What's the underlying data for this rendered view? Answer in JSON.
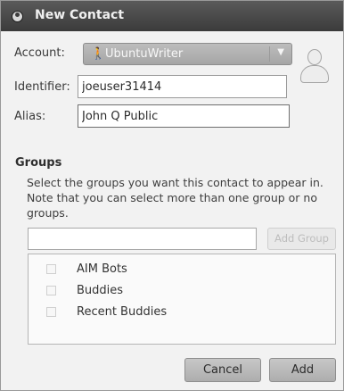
{
  "window": {
    "title": "New Contact",
    "icon": "pidgin-icon"
  },
  "account": {
    "label": "Account:",
    "value": "UbuntuWriter",
    "icon": "aim-person-icon"
  },
  "identifier": {
    "label": "Identifier:",
    "value": "joeuser31414"
  },
  "alias": {
    "label": "Alias:",
    "value": "John Q Public"
  },
  "groups": {
    "title": "Groups",
    "description": "Select the groups you want this contact to appear in. Note that you can select more than one group or no groups.",
    "new_group_value": "",
    "add_group_label": "Add Group",
    "items": [
      {
        "label": "AIM Bots",
        "checked": false
      },
      {
        "label": "Buddies",
        "checked": false
      },
      {
        "label": "Recent Buddies",
        "checked": false
      }
    ]
  },
  "buttons": {
    "cancel": "Cancel",
    "add": "Add"
  }
}
